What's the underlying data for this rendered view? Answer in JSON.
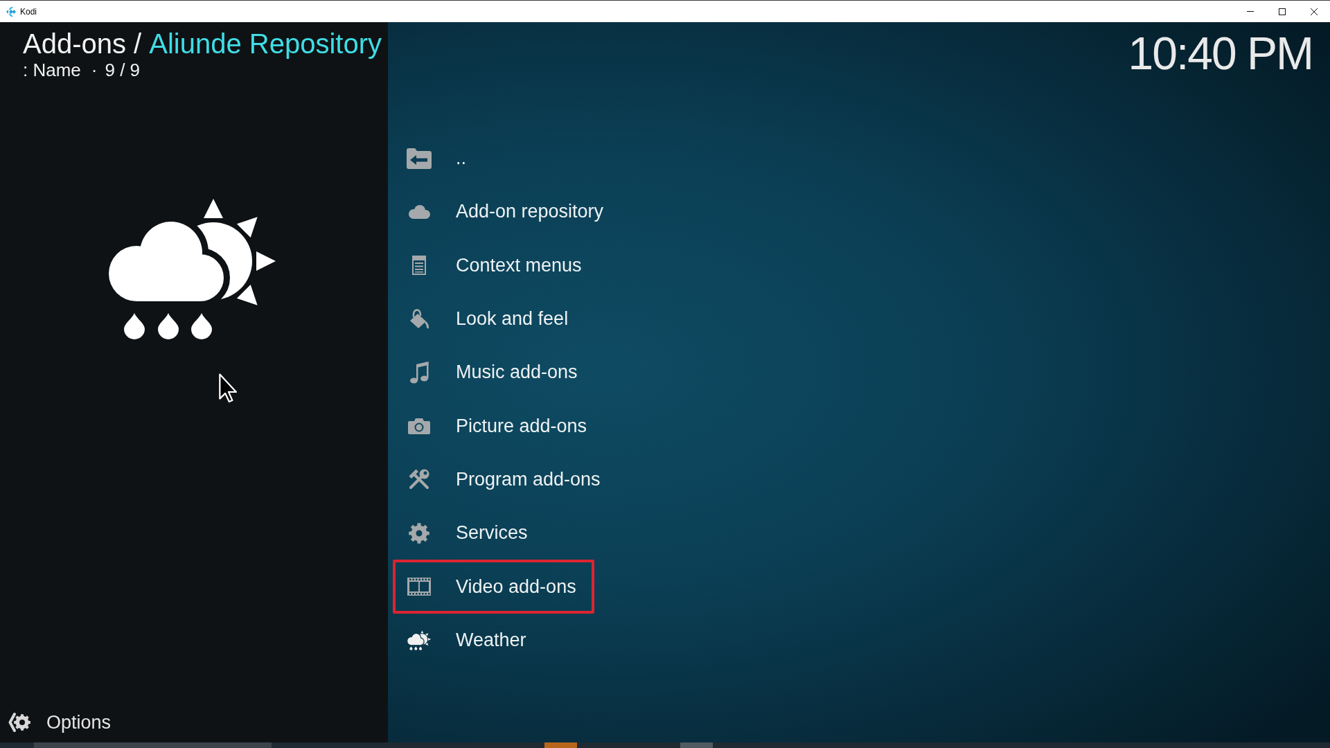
{
  "window": {
    "title": "Kodi"
  },
  "header": {
    "breadcrumb_parent": "Add-ons /",
    "breadcrumb_current": "Aliunde Repository",
    "sort_label": ": Name",
    "separator": "·",
    "count": "9 / 9",
    "clock": "10:40 PM"
  },
  "items": [
    {
      "label": "..",
      "highlighted": false
    },
    {
      "label": "Add-on repository",
      "highlighted": false
    },
    {
      "label": "Context menus",
      "highlighted": false
    },
    {
      "label": "Look and feel",
      "highlighted": false
    },
    {
      "label": "Music add-ons",
      "highlighted": false
    },
    {
      "label": "Picture add-ons",
      "highlighted": false
    },
    {
      "label": "Program add-ons",
      "highlighted": false
    },
    {
      "label": "Services",
      "highlighted": false
    },
    {
      "label": "Video add-ons",
      "highlighted": true
    },
    {
      "label": "Weather",
      "highlighted": false
    }
  ],
  "options_button": {
    "label": "Options"
  }
}
